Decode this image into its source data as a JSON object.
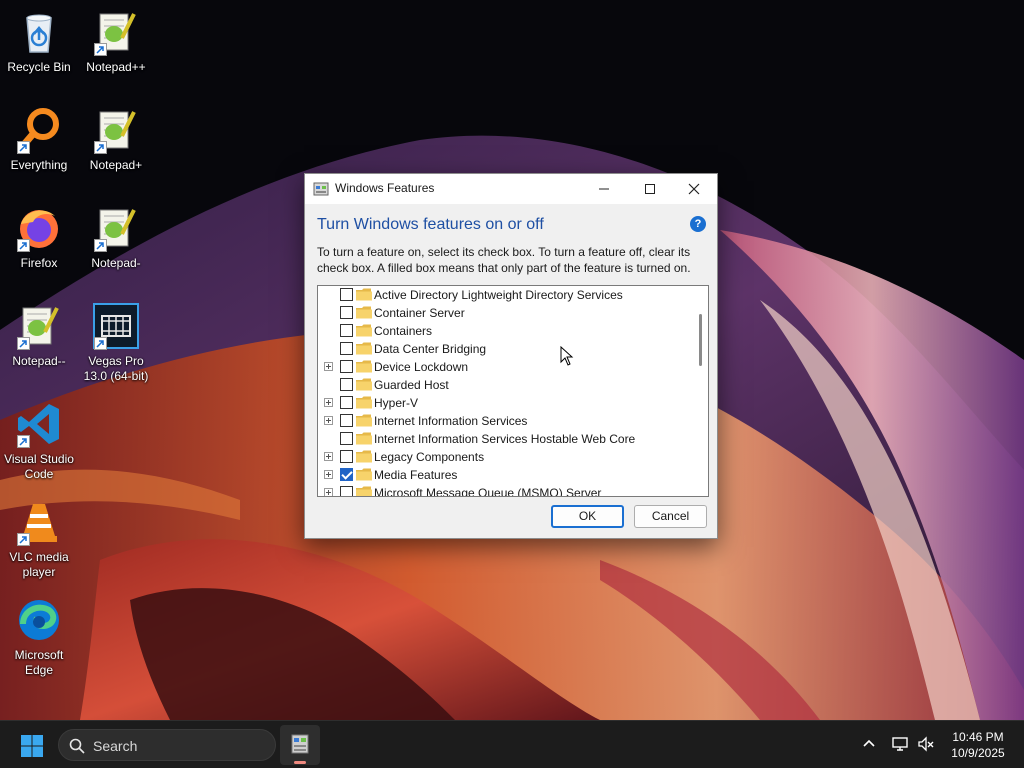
{
  "desktop": {
    "icons": [
      {
        "label": "Recycle Bin",
        "icon": "recycle-bin-icon"
      },
      {
        "label": "Notepad++",
        "icon": "notepad-plus-plus-icon"
      },
      {
        "label": "Everything",
        "icon": "everything-search-icon"
      },
      {
        "label": "Notepad+",
        "icon": "notepad-plus-icon"
      },
      {
        "label": "Firefox",
        "icon": "firefox-icon"
      },
      {
        "label": "Notepad-",
        "icon": "notepad-minus-icon"
      },
      {
        "label": "Notepad--",
        "icon": "notepad-minus-minus-icon"
      },
      {
        "label": "Vegas Pro 13.0 (64-bit)",
        "icon": "vegas-pro-icon"
      },
      {
        "label": "Visual Studio Code",
        "icon": "vscode-icon"
      },
      {
        "label": "VLC media player",
        "icon": "vlc-icon"
      },
      {
        "label": "Microsoft Edge",
        "icon": "edge-icon"
      }
    ]
  },
  "dialog": {
    "title": "Windows Features",
    "heading": "Turn Windows features on or off",
    "help": "?",
    "description": "To turn a feature on, select its check box. To turn a feature off, clear its check box. A filled box means that only part of the feature is turned on.",
    "features": [
      {
        "label": "Active Directory Lightweight Directory Services",
        "expandable": false,
        "checked": false
      },
      {
        "label": "Container Server",
        "expandable": false,
        "checked": false
      },
      {
        "label": "Containers",
        "expandable": false,
        "checked": false
      },
      {
        "label": "Data Center Bridging",
        "expandable": false,
        "checked": false
      },
      {
        "label": "Device Lockdown",
        "expandable": true,
        "checked": false
      },
      {
        "label": "Guarded Host",
        "expandable": false,
        "checked": false
      },
      {
        "label": "Hyper-V",
        "expandable": true,
        "checked": false
      },
      {
        "label": "Internet Information Services",
        "expandable": true,
        "checked": false
      },
      {
        "label": "Internet Information Services Hostable Web Core",
        "expandable": false,
        "checked": false
      },
      {
        "label": "Legacy Components",
        "expandable": true,
        "checked": false
      },
      {
        "label": "Media Features",
        "expandable": true,
        "checked": true
      },
      {
        "label": "Microsoft Message Queue (MSMQ) Server",
        "expandable": true,
        "checked": false
      }
    ],
    "ok_label": "OK",
    "cancel_label": "Cancel"
  },
  "taskbar": {
    "search_placeholder": "Search",
    "clock_time": "10:46 PM",
    "clock_date": "10/9/2025"
  },
  "colors": {
    "accent": "#1a6fd1",
    "heading": "#1e4fa3",
    "taskbar": "#1c1c1c"
  }
}
